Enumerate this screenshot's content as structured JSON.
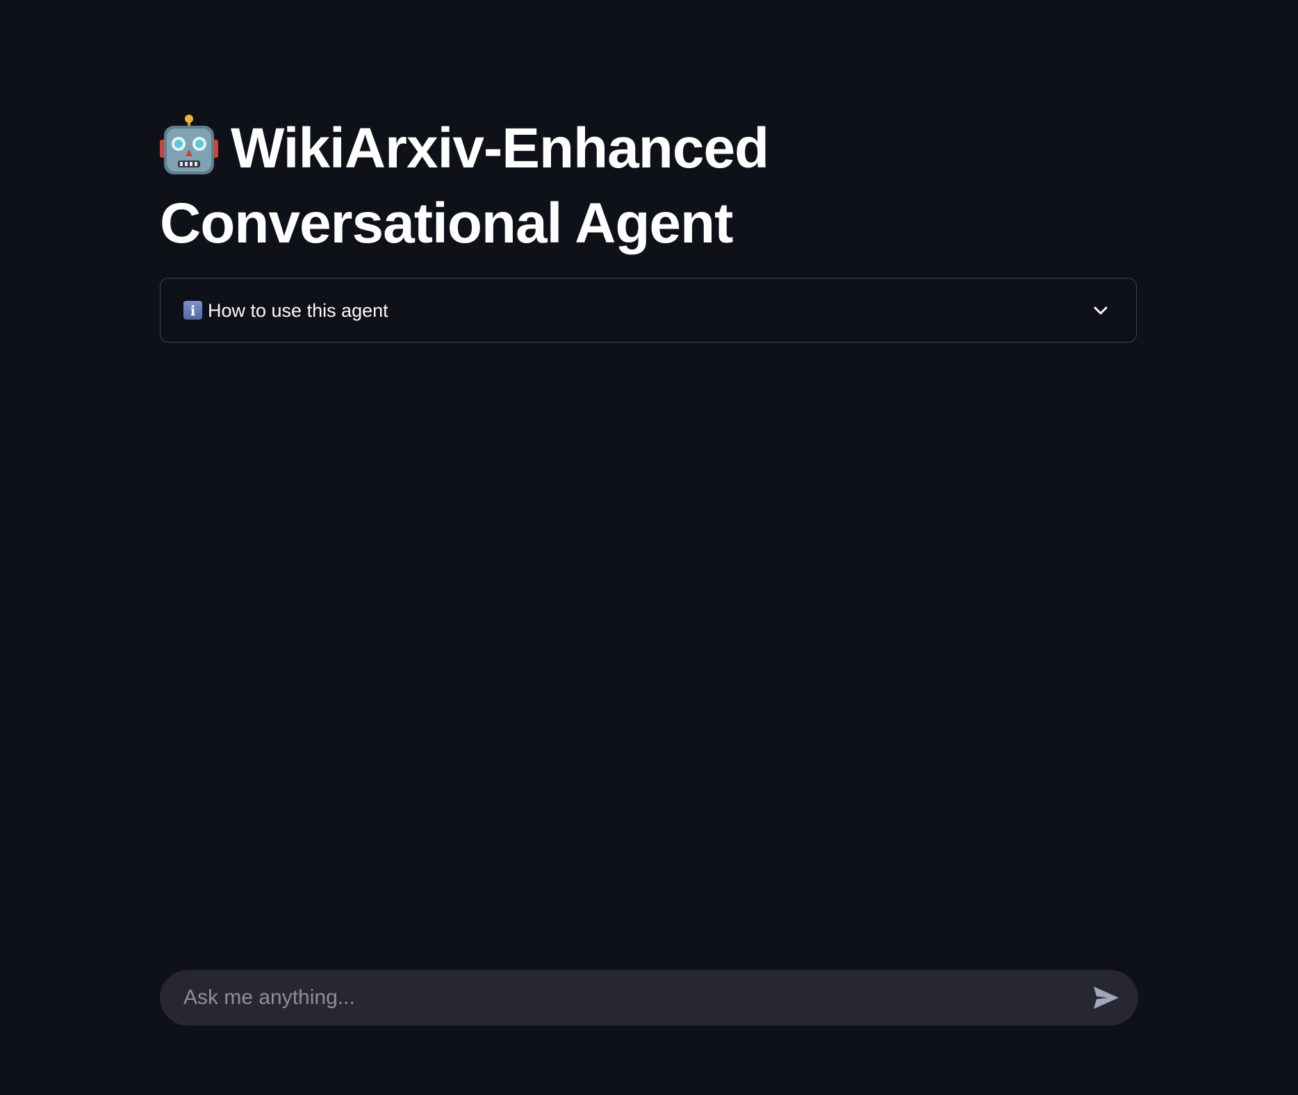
{
  "header": {
    "title_icon": "robot-face-icon",
    "title": "WikiArxiv-Enhanced Conversational Agent"
  },
  "expander": {
    "icon": "info-icon",
    "info_glyph": "i",
    "label": "How to use this agent",
    "chevron_icon": "chevron-down-icon",
    "expanded": false
  },
  "chat": {
    "placeholder": "Ask me anything...",
    "value": "",
    "send_icon": "send-icon"
  },
  "colors": {
    "background": "#0e1117",
    "text": "#fafafa",
    "input_background": "#262730",
    "placeholder": "#8e9099",
    "icon_muted": "#a3a8b8"
  }
}
